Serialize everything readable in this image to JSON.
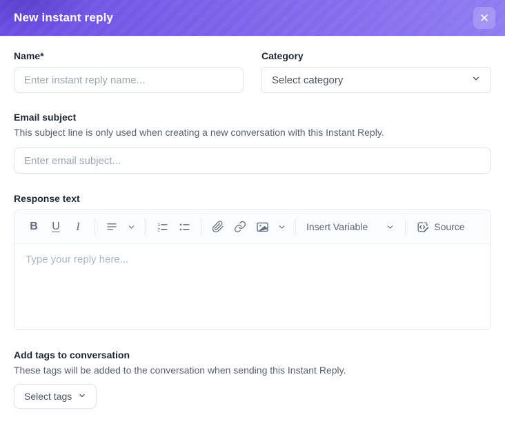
{
  "header": {
    "title": "New instant reply",
    "close_glyph": "✕"
  },
  "form": {
    "name": {
      "label": "Name*",
      "placeholder": "Enter instant reply name..."
    },
    "category": {
      "label": "Category",
      "selected": "Select category"
    },
    "email_subject": {
      "label": "Email subject",
      "helper": "This subject line is only used when creating a new conversation with this Instant Reply.",
      "placeholder": "Enter email subject..."
    },
    "response": {
      "label": "Response text",
      "placeholder": "Type your reply here..."
    },
    "tags": {
      "label": "Add tags to conversation",
      "helper": "These tags will be added to the conversation when sending this Instant Reply.",
      "button_label": "Select tags"
    }
  },
  "toolbar": {
    "bold_label": "B",
    "underline_label": "U",
    "italic_label": "I",
    "insert_variable_label": "Insert Variable",
    "source_label": "Source",
    "icons": [
      "bold",
      "underline",
      "italic",
      "align-left-icon",
      "chevron-down-icon",
      "ordered-list-icon",
      "bullet-list-icon",
      "paperclip-icon",
      "link-icon",
      "image-icon",
      "chevron-down-icon",
      "chevron-down-icon",
      "source-code-icon"
    ]
  },
  "colors": {
    "header_gradient_start": "#6b4ee3",
    "header_gradient_end": "#8f7cf1",
    "label_text": "#1d2733",
    "helper_text": "#566170",
    "placeholder_text": "#9aa7b5",
    "toolbar_icon": "#5d6b7a",
    "input_border": "#dde3e9"
  }
}
